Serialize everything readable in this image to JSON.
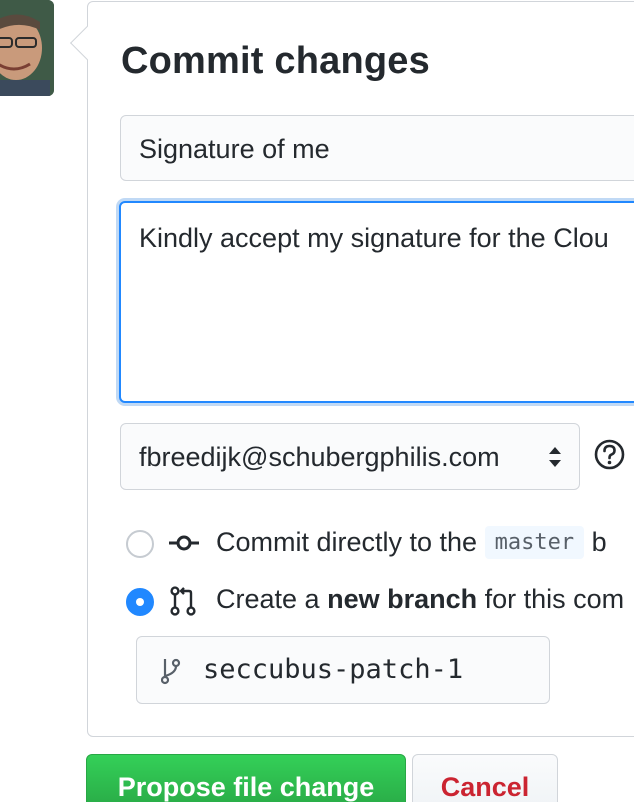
{
  "header": {
    "title": "Commit changes"
  },
  "form": {
    "summary_value": "Signature of me",
    "description_value": "Kindly accept my signature for the Clou",
    "author_email": "fbreedijk@schubergphilis.com"
  },
  "options": {
    "direct": {
      "prefix": "Commit directly to the",
      "branch": "master",
      "suffix": "b",
      "selected": false
    },
    "new_branch": {
      "prefix": "Create a",
      "bold": "new branch",
      "suffix": "for this com",
      "selected": true
    }
  },
  "branch": {
    "name": "seccubus-patch-1"
  },
  "actions": {
    "propose_label": "Propose file change",
    "cancel_label": "Cancel"
  },
  "colors": {
    "accent": "#2188ff",
    "propose_bg": "#28a745",
    "cancel_text": "#cb2431"
  },
  "icons": {
    "select": "chevron-up-down-icon",
    "help": "question-circle-icon",
    "commit": "git-commit-icon",
    "pull_request": "git-pull-request-icon",
    "branch": "git-branch-icon"
  }
}
